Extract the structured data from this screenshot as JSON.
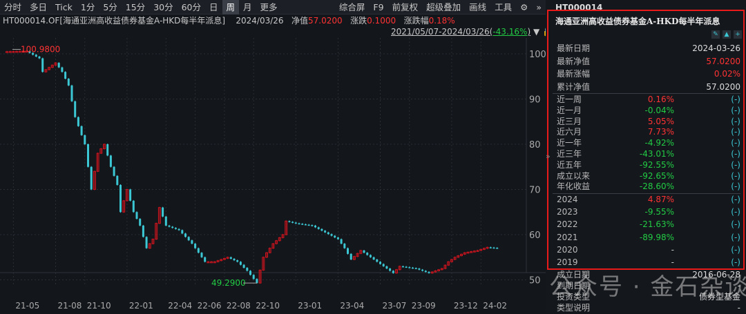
{
  "toolbar": {
    "items": [
      "分时",
      "多日",
      "Tick",
      "1分",
      "5分",
      "15分",
      "30分",
      "60分",
      "日",
      "周",
      "月",
      "更多"
    ],
    "active": "周",
    "right": [
      "综合屏",
      "F9",
      "前复权",
      "超级叠加",
      "画线",
      "工具"
    ]
  },
  "info": {
    "title": "HT000014.OF[海通亚洲高收益债券基金A-HKD每半年派息]",
    "date": "2024/03/26",
    "nav_label": "净值",
    "nav": "57.0200",
    "chg_label": "涨跌",
    "chg": "0.1000",
    "pct_label": "涨跌幅",
    "pct": "0.18%"
  },
  "range": {
    "period": "2021/05/07-2024/03/26(",
    "pct": "-43.16%",
    "close": ")"
  },
  "chart_data": {
    "type": "candlestick",
    "frequency": "weekly",
    "y_ticks": [
      100,
      90,
      80,
      70,
      60,
      50
    ],
    "ylim": [
      47,
      102
    ],
    "x_ticks": [
      "21-05",
      "21-08",
      "21-10",
      "22-01",
      "22-04",
      "22-06",
      "22-08",
      "22-10",
      "23-01",
      "23-04",
      "23-07",
      "23-09",
      "23-12",
      "24-02"
    ],
    "x_tick_weeks": [
      2,
      15,
      24,
      37,
      49,
      58,
      67,
      76,
      89,
      102,
      115,
      124,
      137,
      146
    ],
    "max_label": "100.9800",
    "min_label": "49.2900",
    "close_points": [
      [
        0,
        100.5
      ],
      [
        6,
        100.6
      ],
      [
        10,
        99
      ],
      [
        11,
        96
      ],
      [
        15,
        98
      ],
      [
        17,
        96
      ],
      [
        19,
        93
      ],
      [
        21,
        86
      ],
      [
        22,
        84
      ],
      [
        24,
        80
      ],
      [
        26,
        70
      ],
      [
        28,
        78
      ],
      [
        30,
        80
      ],
      [
        32,
        75
      ],
      [
        34,
        71
      ],
      [
        35,
        65
      ],
      [
        37,
        70
      ],
      [
        39,
        65
      ],
      [
        41,
        62
      ],
      [
        43,
        57
      ],
      [
        45,
        59
      ],
      [
        47,
        66
      ],
      [
        49,
        62
      ],
      [
        53,
        61
      ],
      [
        57,
        58
      ],
      [
        61,
        54
      ],
      [
        64,
        54
      ],
      [
        68,
        55
      ],
      [
        71,
        54
      ],
      [
        74,
        52
      ],
      [
        77,
        49.3
      ],
      [
        79,
        55
      ],
      [
        82,
        58
      ],
      [
        85,
        60
      ],
      [
        86,
        63
      ],
      [
        89,
        62.5
      ],
      [
        94,
        62
      ],
      [
        98,
        60.5
      ],
      [
        102,
        59
      ],
      [
        104,
        57
      ],
      [
        106,
        54.5
      ],
      [
        109,
        56.5
      ],
      [
        111,
        55.5
      ],
      [
        114,
        54
      ],
      [
        117,
        52.5
      ],
      [
        119,
        51.5
      ],
      [
        121,
        53
      ],
      [
        126,
        52.5
      ],
      [
        130,
        51.5
      ],
      [
        134,
        52.5
      ],
      [
        136,
        54
      ],
      [
        138,
        55
      ],
      [
        141,
        56
      ],
      [
        145,
        56.5
      ],
      [
        148,
        57.2
      ],
      [
        151,
        57.02
      ]
    ],
    "colors": {
      "up": "#c8141e",
      "down": "#3cc7d4"
    }
  },
  "panel": {
    "code": "HT000014",
    "name": "海通亚洲高收益债券基金A-HKD每半年派息",
    "top": [
      {
        "k": "最新日期",
        "v": "2024-03-26",
        "c": "#dddddd"
      },
      {
        "k": "最新净值",
        "v": "57.0200",
        "c": "#ff3333"
      },
      {
        "k": "最新涨幅",
        "v": "0.02%",
        "c": "#ff3333"
      },
      {
        "k": "累计净值",
        "v": "57.0200",
        "c": "#dddddd"
      }
    ],
    "perf": [
      {
        "k": "近一周",
        "v": "0.16%",
        "t": "(-)"
      },
      {
        "k": "近一月",
        "v": "-0.04%",
        "t": "(-)"
      },
      {
        "k": "近三月",
        "v": "5.05%",
        "t": "(-)"
      },
      {
        "k": "近六月",
        "v": "7.73%",
        "t": "(-)"
      },
      {
        "k": "近一年",
        "v": "-4.92%",
        "t": "(-)"
      },
      {
        "k": "近三年",
        "v": "-43.01%",
        "t": "(-)"
      },
      {
        "k": "近五年",
        "v": "-92.55%",
        "t": "(-)"
      },
      {
        "k": "成立以来",
        "v": "-92.65%",
        "t": "(-)"
      },
      {
        "k": "年化收益",
        "v": "-28.60%",
        "t": "(-)"
      }
    ],
    "years": [
      {
        "k": "2024",
        "v": "4.87%",
        "t": "(-)"
      },
      {
        "k": "2023",
        "v": "-9.55%",
        "t": "(-)"
      },
      {
        "k": "2022",
        "v": "-21.63%",
        "t": "(-)"
      },
      {
        "k": "2021",
        "v": "-89.98%",
        "t": "(-)"
      },
      {
        "k": "2020",
        "v": "-",
        "t": "(-)"
      },
      {
        "k": "2019",
        "v": "-",
        "t": "(-)"
      }
    ],
    "bottom": [
      {
        "k": "成立日期",
        "v": "2016-06-28"
      },
      {
        "k": "到期日期",
        "v": "-"
      },
      {
        "k": "投资类型",
        "v": "债券型基金"
      },
      {
        "k": "类型说明",
        "v": "-"
      }
    ]
  },
  "watermark": "公众号 · 金石杂谈"
}
